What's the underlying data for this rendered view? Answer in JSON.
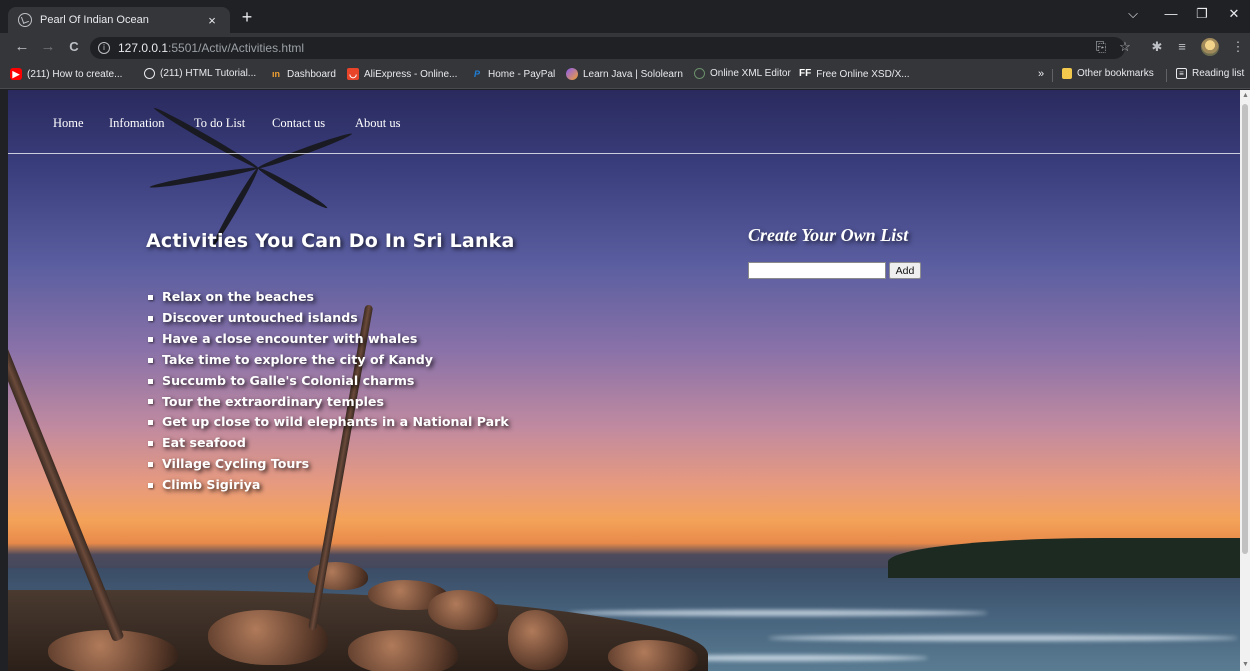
{
  "browser": {
    "tab_title": "Pearl Of Indian Ocean",
    "tab_close": "×",
    "new_tab": "+",
    "window_controls": {
      "minimize": "—",
      "restore": "❐",
      "close": "✕",
      "tabsearch": "⌵"
    },
    "url_host": "127.0.0.1",
    "url_path": ":5501/Activ/Activities.html",
    "nav": {
      "back": "←",
      "forward": "→",
      "reload": "C"
    },
    "toolbar_icons": [
      "share-icon",
      "star-icon",
      "extensions-icon",
      "reading-list-icon",
      "profile-avatar",
      "menu-icon"
    ],
    "bookmarks": [
      {
        "label": "(211) How to create...",
        "icon": "youtube-icon",
        "color": "#ff0000"
      },
      {
        "label": "(211) HTML Tutorial...",
        "icon": "globe-icon",
        "color": "#e8eaed"
      },
      {
        "label": "Dashboard",
        "icon": "dashboard-icon",
        "color": "#f0a030"
      },
      {
        "label": "AliExpress - Online...",
        "icon": "aliexpress-icon",
        "color": "#e8442a"
      },
      {
        "label": "Home - PayPal",
        "icon": "paypal-icon",
        "color": "#1e7fd8"
      },
      {
        "label": "Learn Java | Sololearn",
        "icon": "sololearn-icon",
        "color": "#8a5cf6"
      },
      {
        "label": "Online XML Editor",
        "icon": "xml-editor-icon",
        "color": "#6a8f6a"
      },
      {
        "label": "Free Online XSD/X...",
        "icon": "ff-icon",
        "color": "#ffffff"
      }
    ],
    "bookmarks_overflow": "»",
    "other_bookmarks": "Other bookmarks",
    "reading_list": "Reading list"
  },
  "site": {
    "nav": [
      "Home",
      "Infomation",
      "To do List",
      "Contact us",
      "About us"
    ],
    "heading": "Activities You Can Do In Sri Lanka",
    "activities": [
      "Relax on the beaches",
      "Discover untouched islands",
      "Have a close encounter with whales",
      "Take time to explore the city of Kandy",
      "Succumb to Galle's Colonial charms",
      "Tour the extraordinary temples",
      "Get up close to wild elephants in a National Park",
      "Eat seafood",
      "Village Cycling Tours",
      "Climb Sigiriya"
    ],
    "create_list": {
      "title": "Create Your Own List",
      "input_value": "",
      "button_label": "Add"
    }
  }
}
